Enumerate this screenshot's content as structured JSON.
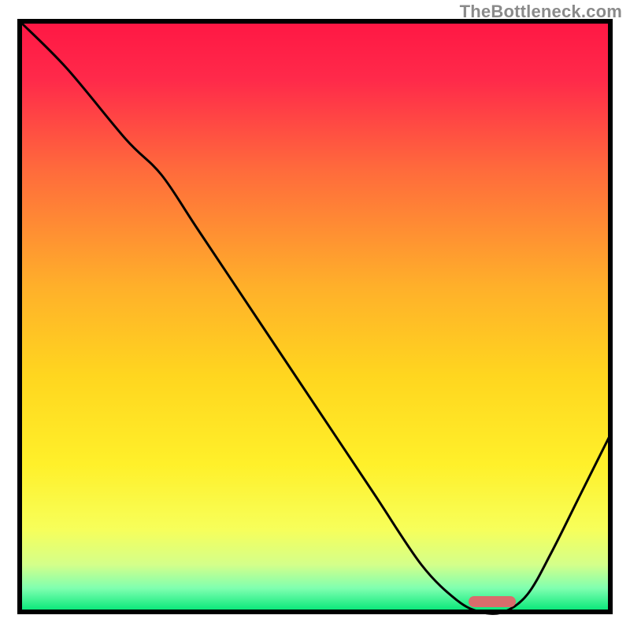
{
  "watermark": "TheBottleneck.com",
  "chart_data": {
    "type": "line",
    "title": "",
    "xlabel": "",
    "ylabel": "",
    "xlim": [
      0,
      100
    ],
    "ylim": [
      0,
      100
    ],
    "x": [
      0,
      8,
      18,
      24,
      30,
      40,
      50,
      60,
      68,
      74,
      78,
      82,
      86,
      90,
      95,
      100
    ],
    "values": [
      100,
      92,
      80,
      74,
      65,
      50,
      35,
      20,
      8,
      2,
      0,
      0,
      3,
      10,
      20,
      30
    ],
    "optimal_range_x": [
      76,
      84
    ],
    "gradient_stops": [
      {
        "offset": 0.0,
        "color": "#ff1744"
      },
      {
        "offset": 0.1,
        "color": "#ff2a4a"
      },
      {
        "offset": 0.25,
        "color": "#ff6a3c"
      },
      {
        "offset": 0.45,
        "color": "#ffb02a"
      },
      {
        "offset": 0.6,
        "color": "#ffd61f"
      },
      {
        "offset": 0.75,
        "color": "#fff02a"
      },
      {
        "offset": 0.86,
        "color": "#f7ff5a"
      },
      {
        "offset": 0.92,
        "color": "#d4ff8a"
      },
      {
        "offset": 0.96,
        "color": "#7fffb0"
      },
      {
        "offset": 1.0,
        "color": "#00e676"
      }
    ],
    "curve_color": "#000000",
    "marker_color": "#d96c6c"
  }
}
